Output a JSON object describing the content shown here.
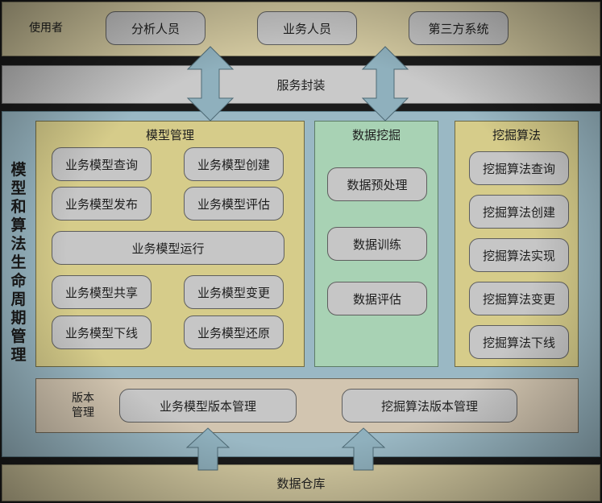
{
  "users": {
    "label": "使用者",
    "items": [
      "分析人员",
      "业务人员",
      "第三方系统"
    ]
  },
  "service_layer": {
    "label": "服务封装"
  },
  "lifecycle_title": [
    "模",
    "型",
    "和",
    "算",
    "法",
    "生",
    "命",
    "周",
    "期",
    "管",
    "理"
  ],
  "model_management": {
    "title": "模型管理",
    "items": [
      "业务模型查询",
      "业务模型创建",
      "业务模型发布",
      "业务模型评估",
      "业务模型运行",
      "业务模型共享",
      "业务模型变更",
      "业务模型下线",
      "业务模型还原"
    ]
  },
  "data_mining": {
    "title": "数据挖掘",
    "items": [
      "数据预处理",
      "数据训练",
      "数据评估"
    ]
  },
  "mining_algorithm": {
    "title": "挖掘算法",
    "items": [
      "挖掘算法查询",
      "挖掘算法创建",
      "挖掘算法实现",
      "挖掘算法变更",
      "挖掘算法下线"
    ]
  },
  "version_management": {
    "label_line1": "版本",
    "label_line2": "管理",
    "items": [
      "业务模型版本管理",
      "挖掘算法版本管理"
    ]
  },
  "data_warehouse": {
    "label": "数据仓库"
  },
  "colors": {
    "user_layer": "#d3c9a0",
    "service_layer": "#c9c9c9",
    "main_area": "#9ab8c4",
    "model_panel": "#d6cc8a",
    "mining_panel": "#a8d2b4",
    "version_panel": "#d2c5b0",
    "arrow_fill": "#8fb0bd"
  }
}
